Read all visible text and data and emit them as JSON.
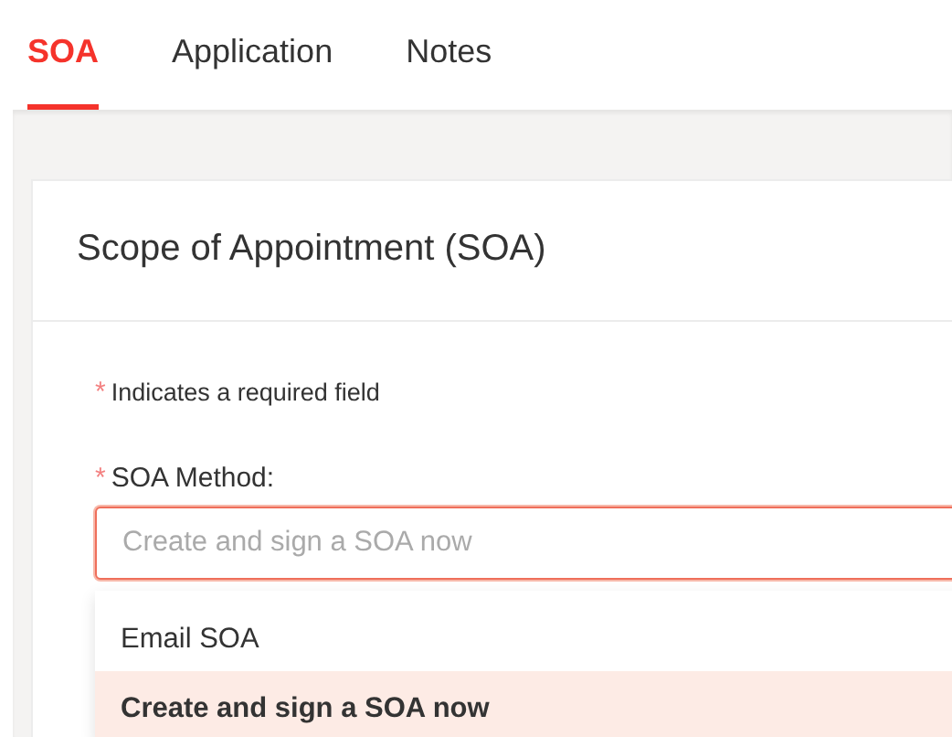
{
  "tabs": [
    {
      "label": "SOA",
      "selected": true
    },
    {
      "label": "Application",
      "selected": false
    },
    {
      "label": "Notes",
      "selected": false
    }
  ],
  "card": {
    "title": "Scope of Appointment (SOA)",
    "required_note": {
      "mark": "*",
      "text": "Indicates a required field"
    },
    "field": {
      "mark": "*",
      "label": "SOA Method:",
      "placeholder": "Create and sign a SOA now",
      "focused": true,
      "options": [
        {
          "label": "Email SOA",
          "selected": false
        },
        {
          "label": "Create and sign a SOA now",
          "selected": true
        }
      ]
    }
  }
}
